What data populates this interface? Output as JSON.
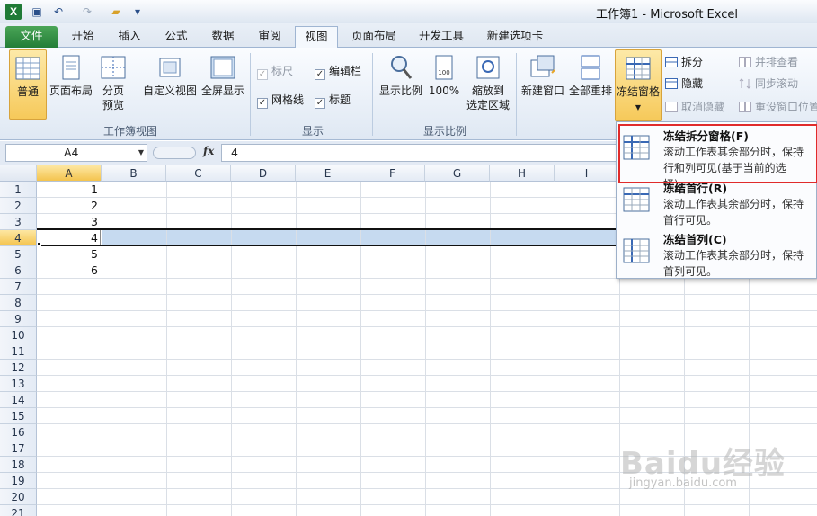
{
  "window": {
    "title": "工作簿1 - Microsoft Excel"
  },
  "tabs": [
    "文件",
    "开始",
    "插入",
    "公式",
    "数据",
    "审阅",
    "视图",
    "页面布局",
    "开发工具",
    "新建选项卡"
  ],
  "active_tab": "视图",
  "ribbon": {
    "workbook_views": {
      "label": "工作簿视图",
      "normal": "普通",
      "page_layout": "页面布局",
      "page_break_1": "分页",
      "page_break_2": "预览",
      "custom_view": "自定义视图",
      "full_screen": "全屏显示"
    },
    "show": {
      "label": "显示",
      "ruler": "标尺",
      "formula_bar": "编辑栏",
      "gridlines": "网格线",
      "headings": "标题"
    },
    "zoom": {
      "label": "显示比例",
      "zoom": "显示比例",
      "pct100": "100%",
      "zoom_sel_1": "缩放到",
      "zoom_sel_2": "选定区域"
    },
    "window": {
      "new_window": "新建窗口",
      "arrange_all": "全部重排",
      "freeze_panes": "冻结窗格",
      "split": "拆分",
      "hide": "隐藏",
      "unhide": "取消隐藏",
      "side_by_side": "并排查看",
      "sync_scroll": "同步滚动",
      "reset_pos": "重设窗口位置"
    }
  },
  "formula_bar": {
    "name_box": "A4",
    "fx": "fx",
    "value": "4"
  },
  "grid": {
    "columns": [
      "A",
      "B",
      "C",
      "D",
      "E",
      "F",
      "G",
      "H",
      "I"
    ],
    "rows": [
      "1",
      "2",
      "3",
      "4",
      "5",
      "6",
      "7",
      "8",
      "9",
      "10",
      "11",
      "12",
      "13",
      "14",
      "15",
      "16",
      "17",
      "18",
      "19",
      "20",
      "21"
    ],
    "colA_values": [
      "1",
      "2",
      "3",
      "4",
      "5",
      "6"
    ],
    "selected_row": "4"
  },
  "freeze_menu": {
    "items": [
      {
        "title": "冻结拆分窗格(F)",
        "desc": "滚动工作表其余部分时，保持行和列可见(基于当前的选择)。"
      },
      {
        "title": "冻结首行(R)",
        "desc": "滚动工作表其余部分时，保持首行可见。"
      },
      {
        "title": "冻结首列(C)",
        "desc": "滚动工作表其余部分时，保持首列可见。"
      }
    ]
  },
  "watermark": {
    "logo": "Baidu经验",
    "url": "jingyan.baidu.com"
  },
  "colors": {
    "accent": "#f6c95a",
    "file_tab": "#237d37",
    "highlight_border": "#e02b2b",
    "row_select": "#c6daf0"
  }
}
